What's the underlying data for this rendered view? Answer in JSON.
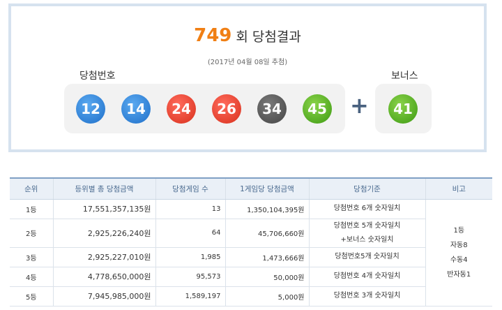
{
  "draw": {
    "number": "749",
    "title_suffix": "회 당첨결과",
    "date": "(2017년 04월 08일 추첨)",
    "winning_label": "당첨번호",
    "bonus_label": "보너스",
    "plus": "+",
    "numbers": [
      "12",
      "14",
      "24",
      "26",
      "34",
      "45"
    ],
    "bonus": "41",
    "ball_colors": {
      "blue": "#1f6fc9",
      "red": "#d8301c",
      "gray": "#444444",
      "green": "#3d9a12"
    }
  },
  "table": {
    "headers": [
      "순위",
      "등위별 총 당첨금액",
      "당첨게임 수",
      "1게임당 당첨금액",
      "당첨기준",
      "비고"
    ],
    "rows": [
      {
        "rank": "1등",
        "total": "17,551,357,135원",
        "games": "13",
        "per_game": "1,350,104,395원",
        "crit1": "당첨번호 6개 숫자일치",
        "crit2": ""
      },
      {
        "rank": "2등",
        "total": "2,925,226,240원",
        "games": "64",
        "per_game": "45,706,660원",
        "crit1": "당첨번호 5개 숫자일치",
        "crit2": "+보너스 숫자일치"
      },
      {
        "rank": "3등",
        "total": "2,925,227,010원",
        "games": "1,985",
        "per_game": "1,473,666원",
        "crit1": "당첨번호5개 숫자일치",
        "crit2": ""
      },
      {
        "rank": "4등",
        "total": "4,778,650,000원",
        "games": "95,573",
        "per_game": "50,000원",
        "crit1": "당첨번호 4개 숫자일치",
        "crit2": ""
      },
      {
        "rank": "5등",
        "total": "7,945,985,000원",
        "games": "1,589,197",
        "per_game": "5,000원",
        "crit1": "당첨번호 3개 숫자일치",
        "crit2": ""
      }
    ],
    "note_lines": [
      "1등",
      "자동8",
      "수동4",
      "반자동1"
    ]
  }
}
